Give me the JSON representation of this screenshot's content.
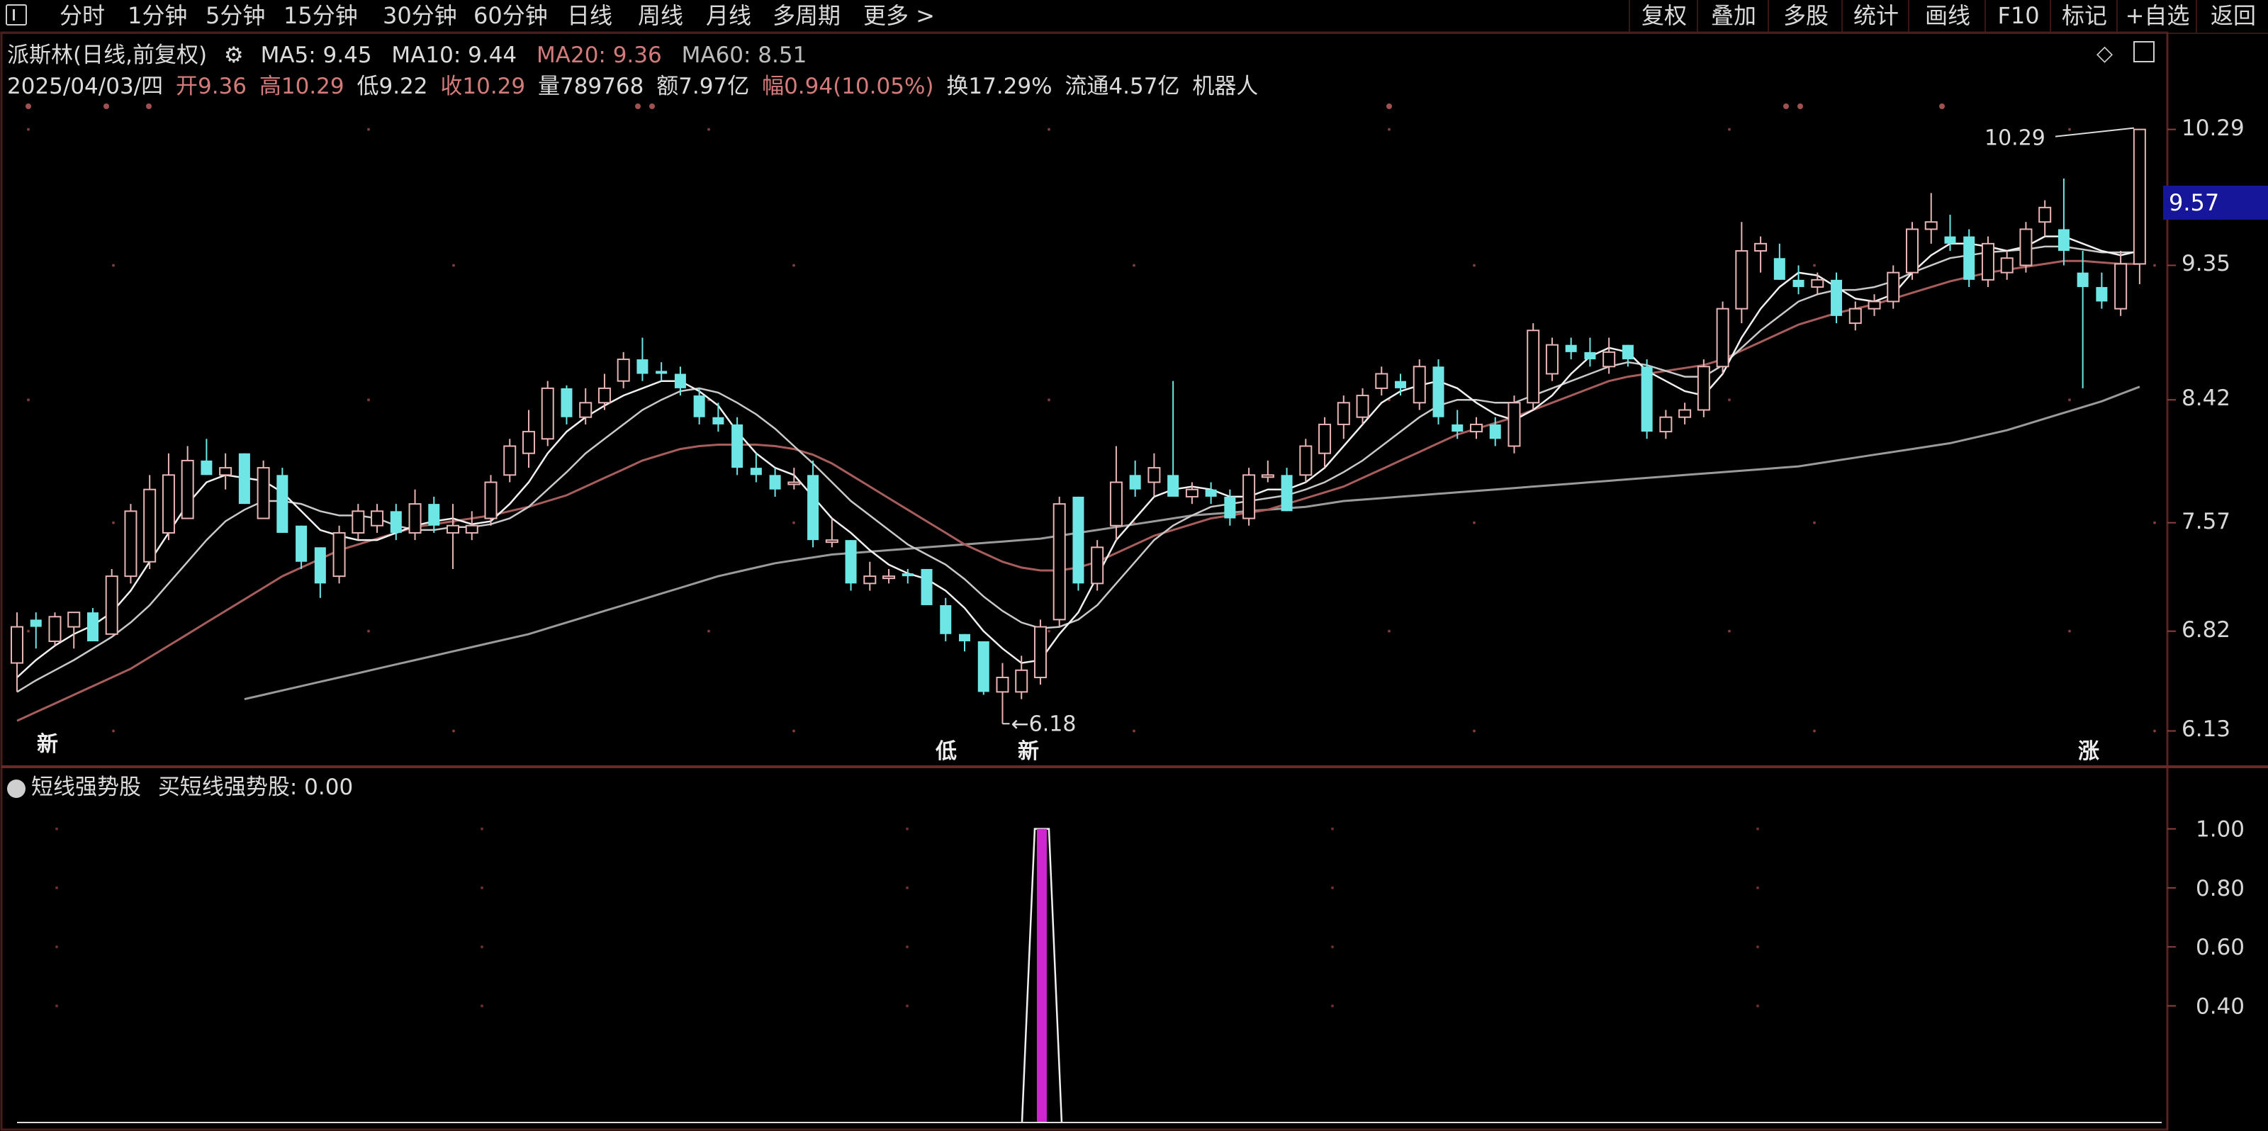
{
  "toolbar": {
    "left_items": [
      "分时",
      "1分钟",
      "5分钟",
      "15分钟",
      "30分钟",
      "60分钟",
      "日线",
      "周线",
      "月线",
      "多周期",
      "更多 >"
    ],
    "right_items": [
      "复权",
      "叠加",
      "多股",
      "统计",
      "画线",
      "F10",
      "标记",
      "+自选",
      "返回"
    ]
  },
  "header": {
    "title": "派斯林(日线,前复权)",
    "ma5": "MA5: 9.45",
    "ma10": "MA10: 9.44",
    "ma20": "MA20: 9.36",
    "ma60": "MA60: 8.51",
    "date": "2025/04/03/四",
    "open": "开9.36",
    "high": "高10.29",
    "low": "低9.22",
    "close": "收10.29",
    "volume": "量789768",
    "amount": "额7.97亿",
    "change": "幅0.94(10.05%)",
    "turnover": "换17.29%",
    "float": "流通4.57亿",
    "concept": "机器人"
  },
  "axis": {
    "price_ticks": [
      "10.29",
      "9.35",
      "8.42",
      "7.57",
      "6.82",
      "6.13"
    ],
    "current_price": "9.57",
    "indicator_ticks": [
      "1.00",
      "0.80",
      "0.60",
      "0.40"
    ]
  },
  "annotations": {
    "high_label": "10.29",
    "low_label": "6.18",
    "markers": [
      "新",
      "低",
      "新",
      "涨"
    ]
  },
  "indicator": {
    "name": "短线强势股",
    "series_label": "买短线强势股: 0.00"
  },
  "colors": {
    "up": "#e8b4b4",
    "down": "#6fe6e6",
    "ma5": "#f0f0f0",
    "ma10": "#c9c9c9",
    "ma20": "#a85d5d",
    "ma60": "#9a9a9a",
    "signal": "#d026d0"
  },
  "chart_data": {
    "type": "candlestick",
    "ylim": [
      6.0,
      10.45
    ],
    "candles": [
      {
        "o": 6.6,
        "h": 6.95,
        "l": 6.4,
        "c": 6.85
      },
      {
        "o": 6.9,
        "h": 6.95,
        "l": 6.7,
        "c": 6.85
      },
      {
        "o": 6.75,
        "h": 6.95,
        "l": 6.72,
        "c": 6.92
      },
      {
        "o": 6.85,
        "h": 6.95,
        "l": 6.7,
        "c": 6.95
      },
      {
        "o": 6.95,
        "h": 6.98,
        "l": 6.75,
        "c": 6.75
      },
      {
        "o": 6.8,
        "h": 7.25,
        "l": 6.8,
        "c": 7.2
      },
      {
        "o": 7.2,
        "h": 7.7,
        "l": 7.15,
        "c": 7.65
      },
      {
        "o": 7.3,
        "h": 7.9,
        "l": 7.25,
        "c": 7.8
      },
      {
        "o": 7.5,
        "h": 8.05,
        "l": 7.45,
        "c": 7.9
      },
      {
        "o": 7.6,
        "h": 8.1,
        "l": 7.6,
        "c": 8.0
      },
      {
        "o": 8.0,
        "h": 8.15,
        "l": 7.9,
        "c": 7.9
      },
      {
        "o": 7.9,
        "h": 8.05,
        "l": 7.8,
        "c": 7.95
      },
      {
        "o": 8.05,
        "h": 8.05,
        "l": 7.7,
        "c": 7.7
      },
      {
        "o": 7.6,
        "h": 8.0,
        "l": 7.6,
        "c": 7.95
      },
      {
        "o": 7.9,
        "h": 7.95,
        "l": 7.5,
        "c": 7.5
      },
      {
        "o": 7.55,
        "h": 7.55,
        "l": 7.25,
        "c": 7.3
      },
      {
        "o": 7.4,
        "h": 7.4,
        "l": 7.05,
        "c": 7.15
      },
      {
        "o": 7.2,
        "h": 7.55,
        "l": 7.15,
        "c": 7.5
      },
      {
        "o": 7.5,
        "h": 7.7,
        "l": 7.45,
        "c": 7.65
      },
      {
        "o": 7.55,
        "h": 7.7,
        "l": 7.5,
        "c": 7.65
      },
      {
        "o": 7.65,
        "h": 7.7,
        "l": 7.45,
        "c": 7.5
      },
      {
        "o": 7.5,
        "h": 7.8,
        "l": 7.45,
        "c": 7.7
      },
      {
        "o": 7.7,
        "h": 7.75,
        "l": 7.5,
        "c": 7.55
      },
      {
        "o": 7.5,
        "h": 7.7,
        "l": 7.25,
        "c": 7.55
      },
      {
        "o": 7.5,
        "h": 7.65,
        "l": 7.45,
        "c": 7.55
      },
      {
        "o": 7.6,
        "h": 7.9,
        "l": 7.55,
        "c": 7.85
      },
      {
        "o": 7.9,
        "h": 8.15,
        "l": 7.85,
        "c": 8.1
      },
      {
        "o": 8.05,
        "h": 8.35,
        "l": 7.95,
        "c": 8.2
      },
      {
        "o": 8.15,
        "h": 8.55,
        "l": 8.1,
        "c": 8.5
      },
      {
        "o": 8.5,
        "h": 8.52,
        "l": 8.25,
        "c": 8.3
      },
      {
        "o": 8.3,
        "h": 8.5,
        "l": 8.25,
        "c": 8.4
      },
      {
        "o": 8.4,
        "h": 8.6,
        "l": 8.35,
        "c": 8.5
      },
      {
        "o": 8.55,
        "h": 8.75,
        "l": 8.5,
        "c": 8.7
      },
      {
        "o": 8.7,
        "h": 8.85,
        "l": 8.55,
        "c": 8.6
      },
      {
        "o": 8.62,
        "h": 8.68,
        "l": 8.55,
        "c": 8.6
      },
      {
        "o": 8.6,
        "h": 8.65,
        "l": 8.45,
        "c": 8.5
      },
      {
        "o": 8.45,
        "h": 8.5,
        "l": 8.25,
        "c": 8.3
      },
      {
        "o": 8.3,
        "h": 8.4,
        "l": 8.2,
        "c": 8.25
      },
      {
        "o": 8.25,
        "h": 8.3,
        "l": 7.9,
        "c": 7.95
      },
      {
        "o": 7.95,
        "h": 8.05,
        "l": 7.85,
        "c": 7.9
      },
      {
        "o": 7.9,
        "h": 7.95,
        "l": 7.75,
        "c": 7.8
      },
      {
        "o": 7.85,
        "h": 7.95,
        "l": 7.8,
        "c": 7.85
      },
      {
        "o": 7.9,
        "h": 8.0,
        "l": 7.4,
        "c": 7.45
      },
      {
        "o": 7.45,
        "h": 7.6,
        "l": 7.4,
        "c": 7.45
      },
      {
        "o": 7.45,
        "h": 7.45,
        "l": 7.1,
        "c": 7.15
      },
      {
        "o": 7.15,
        "h": 7.3,
        "l": 7.1,
        "c": 7.2
      },
      {
        "o": 7.2,
        "h": 7.25,
        "l": 7.15,
        "c": 7.2
      },
      {
        "o": 7.22,
        "h": 7.25,
        "l": 7.15,
        "c": 7.2
      },
      {
        "o": 7.25,
        "h": 7.25,
        "l": 7.0,
        "c": 7.0
      },
      {
        "o": 7.0,
        "h": 7.05,
        "l": 6.75,
        "c": 6.8
      },
      {
        "o": 6.8,
        "h": 6.8,
        "l": 6.68,
        "c": 6.75
      },
      {
        "o": 6.75,
        "h": 6.75,
        "l": 6.38,
        "c": 6.4
      },
      {
        "o": 6.4,
        "h": 6.6,
        "l": 6.18,
        "c": 6.5
      },
      {
        "o": 6.4,
        "h": 6.65,
        "l": 6.35,
        "c": 6.55
      },
      {
        "o": 6.5,
        "h": 6.9,
        "l": 6.45,
        "c": 6.85
      },
      {
        "o": 6.9,
        "h": 7.75,
        "l": 6.85,
        "c": 7.7
      },
      {
        "o": 7.75,
        "h": 7.75,
        "l": 7.1,
        "c": 7.15
      },
      {
        "o": 7.15,
        "h": 7.45,
        "l": 7.1,
        "c": 7.4
      },
      {
        "o": 7.55,
        "h": 8.1,
        "l": 7.45,
        "c": 7.85
      },
      {
        "o": 7.9,
        "h": 8.0,
        "l": 7.75,
        "c": 7.8
      },
      {
        "o": 7.85,
        "h": 8.05,
        "l": 7.75,
        "c": 7.95
      },
      {
        "o": 7.9,
        "h": 8.55,
        "l": 7.8,
        "c": 7.75
      },
      {
        "o": 7.75,
        "h": 7.85,
        "l": 7.7,
        "c": 7.8
      },
      {
        "o": 7.8,
        "h": 7.85,
        "l": 7.7,
        "c": 7.75
      },
      {
        "o": 7.75,
        "h": 7.8,
        "l": 7.55,
        "c": 7.6
      },
      {
        "o": 7.6,
        "h": 7.95,
        "l": 7.55,
        "c": 7.9
      },
      {
        "o": 7.9,
        "h": 8.0,
        "l": 7.85,
        "c": 7.9
      },
      {
        "o": 7.9,
        "h": 7.95,
        "l": 7.65,
        "c": 7.65
      },
      {
        "o": 7.9,
        "h": 8.15,
        "l": 7.85,
        "c": 8.1
      },
      {
        "o": 8.05,
        "h": 8.3,
        "l": 7.95,
        "c": 8.25
      },
      {
        "o": 8.25,
        "h": 8.45,
        "l": 8.15,
        "c": 8.4
      },
      {
        "o": 8.3,
        "h": 8.5,
        "l": 8.25,
        "c": 8.45
      },
      {
        "o": 8.5,
        "h": 8.65,
        "l": 8.45,
        "c": 8.6
      },
      {
        "o": 8.55,
        "h": 8.6,
        "l": 8.45,
        "c": 8.5
      },
      {
        "o": 8.4,
        "h": 8.7,
        "l": 8.35,
        "c": 8.65
      },
      {
        "o": 8.65,
        "h": 8.7,
        "l": 8.25,
        "c": 8.3
      },
      {
        "o": 8.25,
        "h": 8.35,
        "l": 8.15,
        "c": 8.2
      },
      {
        "o": 8.2,
        "h": 8.3,
        "l": 8.15,
        "c": 8.25
      },
      {
        "o": 8.25,
        "h": 8.3,
        "l": 8.1,
        "c": 8.15
      },
      {
        "o": 8.1,
        "h": 8.45,
        "l": 8.05,
        "c": 8.4
      },
      {
        "o": 8.4,
        "h": 8.95,
        "l": 8.35,
        "c": 8.9
      },
      {
        "o": 8.6,
        "h": 8.85,
        "l": 8.55,
        "c": 8.8
      },
      {
        "o": 8.8,
        "h": 8.85,
        "l": 8.7,
        "c": 8.75
      },
      {
        "o": 8.75,
        "h": 8.85,
        "l": 8.65,
        "c": 8.7
      },
      {
        "o": 8.65,
        "h": 8.85,
        "l": 8.6,
        "c": 8.75
      },
      {
        "o": 8.8,
        "h": 8.8,
        "l": 8.65,
        "c": 8.7
      },
      {
        "o": 8.65,
        "h": 8.7,
        "l": 8.15,
        "c": 8.2
      },
      {
        "o": 8.2,
        "h": 8.35,
        "l": 8.15,
        "c": 8.3
      },
      {
        "o": 8.3,
        "h": 8.4,
        "l": 8.25,
        "c": 8.35
      },
      {
        "o": 8.35,
        "h": 8.7,
        "l": 8.3,
        "c": 8.65
      },
      {
        "o": 8.65,
        "h": 9.1,
        "l": 8.6,
        "c": 9.05
      },
      {
        "o": 9.05,
        "h": 9.65,
        "l": 8.95,
        "c": 9.45
      },
      {
        "o": 9.45,
        "h": 9.55,
        "l": 9.3,
        "c": 9.5
      },
      {
        "o": 9.4,
        "h": 9.5,
        "l": 9.25,
        "c": 9.25
      },
      {
        "o": 9.25,
        "h": 9.35,
        "l": 9.15,
        "c": 9.2
      },
      {
        "o": 9.2,
        "h": 9.3,
        "l": 9.15,
        "c": 9.25
      },
      {
        "o": 9.25,
        "h": 9.3,
        "l": 8.95,
        "c": 9.0
      },
      {
        "o": 8.95,
        "h": 9.1,
        "l": 8.9,
        "c": 9.05
      },
      {
        "o": 9.05,
        "h": 9.15,
        "l": 9.0,
        "c": 9.1
      },
      {
        "o": 9.1,
        "h": 9.35,
        "l": 9.05,
        "c": 9.3
      },
      {
        "o": 9.3,
        "h": 9.65,
        "l": 9.25,
        "c": 9.6
      },
      {
        "o": 9.6,
        "h": 9.85,
        "l": 9.5,
        "c": 9.65
      },
      {
        "o": 9.55,
        "h": 9.7,
        "l": 9.45,
        "c": 9.5
      },
      {
        "o": 9.55,
        "h": 9.6,
        "l": 9.2,
        "c": 9.25
      },
      {
        "o": 9.25,
        "h": 9.55,
        "l": 9.2,
        "c": 9.5
      },
      {
        "o": 9.3,
        "h": 9.45,
        "l": 9.25,
        "c": 9.4
      },
      {
        "o": 9.35,
        "h": 9.65,
        "l": 9.3,
        "c": 9.6
      },
      {
        "o": 9.65,
        "h": 9.8,
        "l": 9.55,
        "c": 9.75
      },
      {
        "o": 9.6,
        "h": 9.95,
        "l": 9.35,
        "c": 9.45
      },
      {
        "o": 9.3,
        "h": 9.45,
        "l": 8.5,
        "c": 9.2
      },
      {
        "o": 9.2,
        "h": 9.3,
        "l": 9.05,
        "c": 9.1
      },
      {
        "o": 9.05,
        "h": 9.45,
        "l": 9.0,
        "c": 9.36
      },
      {
        "o": 9.36,
        "h": 10.29,
        "l": 9.22,
        "c": 10.29
      }
    ],
    "ma": {
      "ma5": [
        6.5,
        6.62,
        6.72,
        6.8,
        6.86,
        6.95,
        7.1,
        7.3,
        7.5,
        7.7,
        7.85,
        7.9,
        7.88,
        7.86,
        7.78,
        7.65,
        7.52,
        7.48,
        7.45,
        7.45,
        7.5,
        7.55,
        7.58,
        7.6,
        7.56,
        7.58,
        7.7,
        7.85,
        8.05,
        8.2,
        8.3,
        8.38,
        8.45,
        8.5,
        8.55,
        8.55,
        8.48,
        8.38,
        8.2,
        8.05,
        7.95,
        7.9,
        7.75,
        7.6,
        7.5,
        7.38,
        7.28,
        7.22,
        7.18,
        7.1,
        6.98,
        6.82,
        6.7,
        6.6,
        6.62,
        6.8,
        6.95,
        7.2,
        7.45,
        7.6,
        7.75,
        7.8,
        7.82,
        7.8,
        7.75,
        7.75,
        7.8,
        7.8,
        7.85,
        7.95,
        8.1,
        8.25,
        8.4,
        8.48,
        8.52,
        8.55,
        8.5,
        8.4,
        8.32,
        8.28,
        8.35,
        8.45,
        8.6,
        8.72,
        8.78,
        8.75,
        8.62,
        8.55,
        8.48,
        8.45,
        8.6,
        8.85,
        9.05,
        9.2,
        9.3,
        9.28,
        9.2,
        9.12,
        9.1,
        9.15,
        9.3,
        9.42,
        9.5,
        9.5,
        9.48,
        9.45,
        9.48,
        9.55,
        9.55,
        9.5,
        9.45,
        9.42,
        9.45
      ],
      "ma10": [
        6.4,
        6.48,
        6.55,
        6.62,
        6.7,
        6.78,
        6.88,
        7.0,
        7.15,
        7.3,
        7.45,
        7.58,
        7.66,
        7.72,
        7.72,
        7.7,
        7.65,
        7.62,
        7.62,
        7.6,
        7.55,
        7.52,
        7.52,
        7.54,
        7.54,
        7.56,
        7.6,
        7.68,
        7.8,
        7.92,
        8.05,
        8.15,
        8.25,
        8.35,
        8.42,
        8.48,
        8.5,
        8.47,
        8.4,
        8.32,
        8.22,
        8.1,
        7.98,
        7.85,
        7.72,
        7.62,
        7.52,
        7.42,
        7.35,
        7.28,
        7.18,
        7.06,
        6.96,
        6.88,
        6.84,
        6.85,
        6.9,
        7.0,
        7.15,
        7.3,
        7.45,
        7.55,
        7.62,
        7.68,
        7.7,
        7.72,
        7.74,
        7.76,
        7.8,
        7.85,
        7.92,
        8.0,
        8.1,
        8.2,
        8.3,
        8.38,
        8.42,
        8.42,
        8.4,
        8.4,
        8.45,
        8.5,
        8.55,
        8.6,
        8.65,
        8.68,
        8.66,
        8.62,
        8.58,
        8.58,
        8.66,
        8.78,
        8.9,
        9.0,
        9.1,
        9.15,
        9.18,
        9.18,
        9.2,
        9.24,
        9.3,
        9.35,
        9.4,
        9.42,
        9.44,
        9.45,
        9.46,
        9.48,
        9.48,
        9.46,
        9.44,
        9.44,
        9.44
      ],
      "ma20": [
        6.2,
        6.26,
        6.32,
        6.38,
        6.44,
        6.5,
        6.56,
        6.64,
        6.72,
        6.8,
        6.88,
        6.96,
        7.04,
        7.12,
        7.2,
        7.26,
        7.32,
        7.38,
        7.42,
        7.46,
        7.5,
        7.54,
        7.56,
        7.58,
        7.6,
        7.62,
        7.65,
        7.68,
        7.72,
        7.76,
        7.82,
        7.88,
        7.94,
        8.0,
        8.04,
        8.08,
        8.1,
        8.11,
        8.11,
        8.11,
        8.1,
        8.08,
        8.04,
        7.98,
        7.9,
        7.82,
        7.74,
        7.66,
        7.58,
        7.5,
        7.42,
        7.36,
        7.3,
        7.26,
        7.24,
        7.24,
        7.26,
        7.3,
        7.36,
        7.42,
        7.48,
        7.52,
        7.56,
        7.6,
        7.62,
        7.64,
        7.66,
        7.7,
        7.74,
        7.78,
        7.82,
        7.88,
        7.94,
        8.0,
        8.06,
        8.12,
        8.18,
        8.22,
        8.26,
        8.3,
        8.35,
        8.4,
        8.45,
        8.5,
        8.55,
        8.58,
        8.6,
        8.62,
        8.64,
        8.66,
        8.7,
        8.76,
        8.82,
        8.88,
        8.94,
        8.98,
        9.02,
        9.05,
        9.08,
        9.12,
        9.16,
        9.2,
        9.24,
        9.27,
        9.3,
        9.32,
        9.34,
        9.36,
        9.38,
        9.38,
        9.37,
        9.36,
        9.36
      ],
      "ma60": [
        null,
        null,
        null,
        null,
        null,
        null,
        null,
        null,
        null,
        null,
        null,
        null,
        6.35,
        6.38,
        6.41,
        6.44,
        6.47,
        6.5,
        6.53,
        6.56,
        6.59,
        6.62,
        6.65,
        6.68,
        6.71,
        6.74,
        6.77,
        6.8,
        6.84,
        6.88,
        6.92,
        6.96,
        7.0,
        7.04,
        7.08,
        7.12,
        7.16,
        7.2,
        7.23,
        7.26,
        7.29,
        7.31,
        7.33,
        7.35,
        7.36,
        7.37,
        7.38,
        7.39,
        7.4,
        7.41,
        7.42,
        7.43,
        7.44,
        7.45,
        7.46,
        7.48,
        7.5,
        7.52,
        7.54,
        7.56,
        7.58,
        7.6,
        7.62,
        7.63,
        7.64,
        7.65,
        7.66,
        7.67,
        7.68,
        7.7,
        7.72,
        7.73,
        7.74,
        7.75,
        7.76,
        7.77,
        7.78,
        7.79,
        7.8,
        7.81,
        7.82,
        7.83,
        7.84,
        7.85,
        7.86,
        7.87,
        7.88,
        7.89,
        7.9,
        7.91,
        7.92,
        7.93,
        7.94,
        7.95,
        7.96,
        7.98,
        8.0,
        8.02,
        8.04,
        8.06,
        8.08,
        8.1,
        8.12,
        8.15,
        8.18,
        8.21,
        8.25,
        8.29,
        8.33,
        8.37,
        8.41,
        8.46,
        8.51
      ]
    },
    "indicator_values": {
      "series": "买短线强势股",
      "peak_index": 54,
      "peak_value": 1.0,
      "ylim": [
        0,
        1.1
      ]
    }
  }
}
